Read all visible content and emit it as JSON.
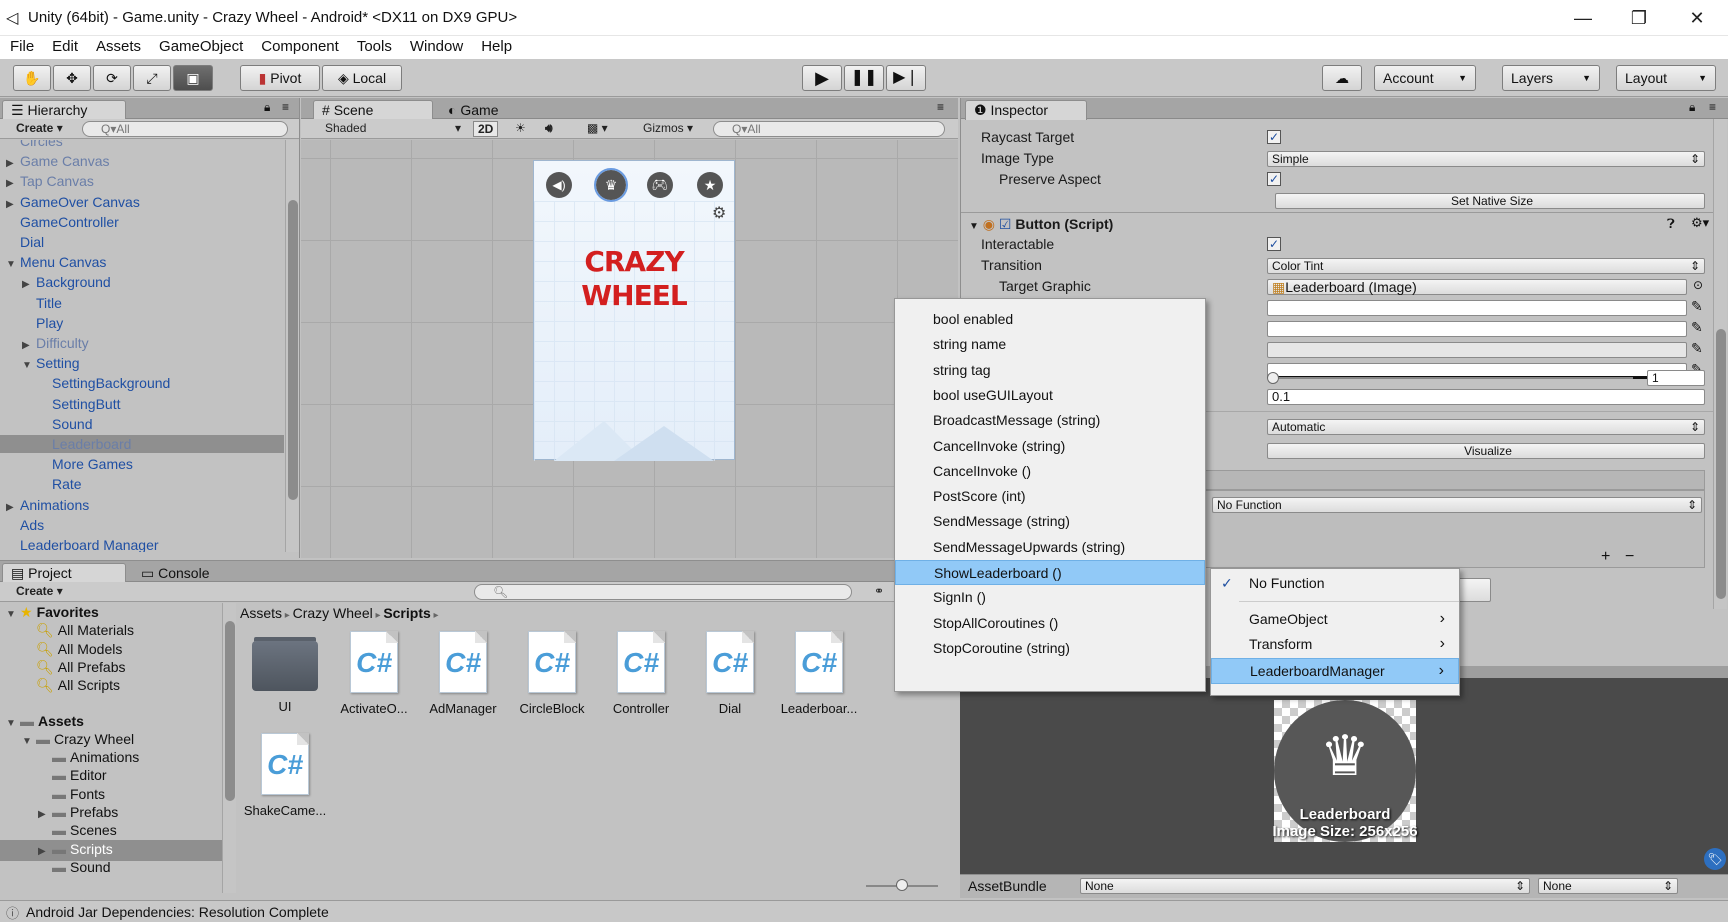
{
  "window": {
    "title": "Unity (64bit) - Game.unity - Crazy Wheel - Android* <DX11 on DX9 GPU>",
    "min": "—",
    "max": "❐",
    "close": "✕"
  },
  "menu": [
    "File",
    "Edit",
    "Assets",
    "GameObject",
    "Component",
    "Tools",
    "Window",
    "Help"
  ],
  "toolbar": {
    "pivot": "Pivot",
    "local": "Local",
    "account": "Account",
    "layers": "Layers",
    "layout": "Layout"
  },
  "hierarchy": {
    "tab": "Hierarchy",
    "create": "Create",
    "search_placeholder": "Q▾All",
    "items": [
      {
        "label": "Circles",
        "indent": 0,
        "arrow": false,
        "style": "faded"
      },
      {
        "label": "Game Canvas",
        "indent": 0,
        "arrow": "▶",
        "style": "faded"
      },
      {
        "label": "Tap Canvas",
        "indent": 0,
        "arrow": "▶",
        "style": "faded"
      },
      {
        "label": "GameOver Canvas",
        "indent": 0,
        "arrow": "▶",
        "style": "blue"
      },
      {
        "label": "GameController",
        "indent": 0,
        "arrow": false,
        "style": "blue"
      },
      {
        "label": "Dial",
        "indent": 0,
        "arrow": false,
        "style": "blue"
      },
      {
        "label": "Menu Canvas",
        "indent": 0,
        "arrow": "▼",
        "style": "blue"
      },
      {
        "label": "Background",
        "indent": 1,
        "arrow": "▶",
        "style": "blue"
      },
      {
        "label": "Title",
        "indent": 1,
        "arrow": false,
        "style": "blue"
      },
      {
        "label": "Play",
        "indent": 1,
        "arrow": false,
        "style": "blue"
      },
      {
        "label": "Difficulty",
        "indent": 1,
        "arrow": "▶",
        "style": "faded"
      },
      {
        "label": "Setting",
        "indent": 1,
        "arrow": "▼",
        "style": "blue"
      },
      {
        "label": "SettingBackground",
        "indent": 2,
        "arrow": false,
        "style": "blue"
      },
      {
        "label": "SettingButt",
        "indent": 2,
        "arrow": false,
        "style": "blue"
      },
      {
        "label": "Sound",
        "indent": 2,
        "arrow": false,
        "style": "blue"
      },
      {
        "label": "Leaderboard",
        "indent": 2,
        "arrow": false,
        "style": "faded",
        "selected": true
      },
      {
        "label": "More Games",
        "indent": 2,
        "arrow": false,
        "style": "blue"
      },
      {
        "label": "Rate",
        "indent": 2,
        "arrow": false,
        "style": "blue"
      },
      {
        "label": "Animations",
        "indent": 0,
        "arrow": "▶",
        "style": "blue"
      },
      {
        "label": "Ads",
        "indent": 0,
        "arrow": false,
        "style": "blue"
      },
      {
        "label": "Leaderboard Manager",
        "indent": 0,
        "arrow": false,
        "style": "blue"
      }
    ]
  },
  "scene": {
    "tab_scene": "Scene",
    "tab_game": "Game",
    "shaded": "Shaded",
    "mode2d": "2D",
    "gizmos": "Gizmos",
    "search_placeholder": "Q▾All",
    "title_line1": "CRAZY",
    "title_line2": "WHEEL"
  },
  "inspector": {
    "tab": "Inspector",
    "raycast_label": "Raycast Target",
    "image_type_label": "Image Type",
    "image_type_value": "Simple",
    "preserve_label": "Preserve Aspect",
    "native_size_btn": "Set Native Size",
    "button_component": "Button (Script)",
    "interactable_label": "Interactable",
    "transition_label": "Transition",
    "transition_value": "Color Tint",
    "target_graphic_label": "Target Graphic",
    "target_graphic_value": "Leaderboard (Image)",
    "color_multiplier": "1",
    "fade_duration": "0.1",
    "navigation_value": "Automatic",
    "visualize_btn": "Visualize",
    "no_function": "No Function",
    "plus": "+",
    "minus": "−",
    "asset_bundle_label": "AssetBundle",
    "asset_bundle_value": "None",
    "asset_variant_value": "None",
    "preview_name": "Leaderboard",
    "preview_size": "Image Size: 256x256"
  },
  "context_menu": {
    "items": [
      "bool enabled",
      "string name",
      "string tag",
      "bool useGUILayout",
      "BroadcastMessage (string)",
      "CancelInvoke (string)",
      "CancelInvoke ()",
      "PostScore (int)",
      "SendMessage (string)",
      "SendMessageUpwards (string)",
      "ShowLeaderboard ()",
      "SignIn ()",
      "StopAllCoroutines ()",
      "StopCoroutine (string)"
    ],
    "highlighted": "ShowLeaderboard ()"
  },
  "submenu": {
    "items": [
      {
        "label": "No Function",
        "checked": true,
        "arrow": false
      },
      {
        "label": "GameObject",
        "checked": false,
        "arrow": true
      },
      {
        "label": "Transform",
        "checked": false,
        "arrow": true
      },
      {
        "label": "LeaderboardManager",
        "checked": false,
        "arrow": true,
        "highlighted": true
      }
    ]
  },
  "project": {
    "tab_project": "Project",
    "tab_console": "Console",
    "create": "Create",
    "favorites_label": "Favorites",
    "favorites": [
      "All Materials",
      "All Models",
      "All Prefabs",
      "All Scripts"
    ],
    "assets_label": "Assets",
    "tree": [
      {
        "label": "Crazy Wheel",
        "indent": 1,
        "arrow": "▼"
      },
      {
        "label": "Animations",
        "indent": 2,
        "arrow": false
      },
      {
        "label": "Editor",
        "indent": 2,
        "arrow": false
      },
      {
        "label": "Fonts",
        "indent": 2,
        "arrow": false
      },
      {
        "label": "Prefabs",
        "indent": 2,
        "arrow": "▶"
      },
      {
        "label": "Scenes",
        "indent": 2,
        "arrow": false
      },
      {
        "label": "Scripts",
        "indent": 2,
        "arrow": "▶",
        "selected": true
      },
      {
        "label": "Sound",
        "indent": 2,
        "arrow": false
      }
    ],
    "breadcrumb": [
      "Assets",
      "Crazy Wheel",
      "Scripts"
    ],
    "assets": [
      {
        "label": "UI",
        "type": "folder"
      },
      {
        "label": "ActivateO...",
        "type": "cs"
      },
      {
        "label": "AdManager",
        "type": "cs"
      },
      {
        "label": "CircleBlock",
        "type": "cs"
      },
      {
        "label": "Controller",
        "type": "cs"
      },
      {
        "label": "Dial",
        "type": "cs"
      },
      {
        "label": "Leaderboar...",
        "type": "cs"
      },
      {
        "label": "ShakeCame...",
        "type": "cs"
      }
    ]
  },
  "status": "Android Jar Dependencies: Resolution Complete",
  "colors": {
    "accent": "#91c9f7",
    "panel": "#c2c2c2",
    "header": "#a5a5a5",
    "brand_red": "#d31f1f"
  }
}
